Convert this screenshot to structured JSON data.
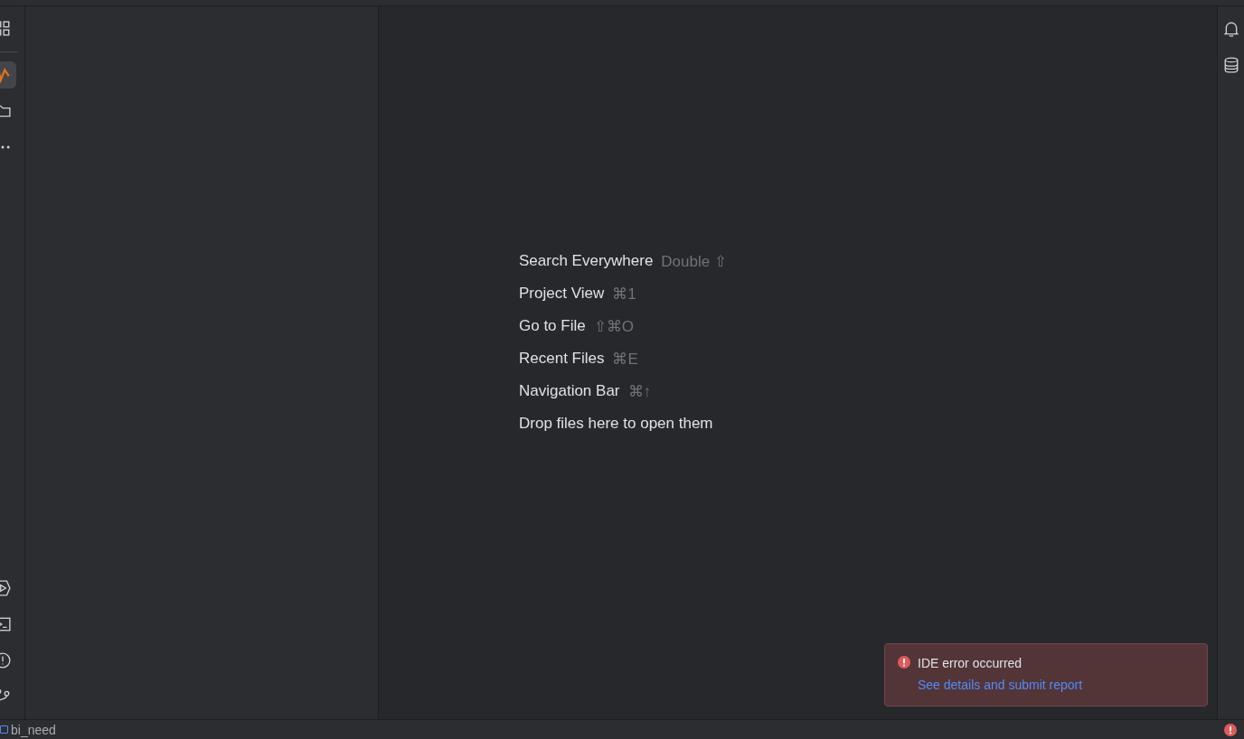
{
  "left_toolbar": {
    "top": [
      {
        "kind": "grid",
        "selected": false
      },
      {
        "kind": "chart",
        "selected": true
      },
      {
        "kind": "folder",
        "selected": false
      },
      {
        "kind": "more",
        "selected": false
      }
    ],
    "bottom": [
      {
        "kind": "run",
        "selected": false
      },
      {
        "kind": "terminal",
        "selected": false
      },
      {
        "kind": "problems",
        "selected": false
      },
      {
        "kind": "branch",
        "selected": false
      }
    ]
  },
  "editor_hints": [
    {
      "label": "Search Everywhere",
      "shortcut": "Double ⇧"
    },
    {
      "label": "Project View",
      "shortcut": "⌘1"
    },
    {
      "label": "Go to File",
      "shortcut": "⇧⌘O"
    },
    {
      "label": "Recent Files",
      "shortcut": "⌘E"
    },
    {
      "label": "Navigation Bar",
      "shortcut": "⌘↑"
    },
    {
      "label": "Drop files here to open them"
    }
  ],
  "right_toolbar": [
    {
      "kind": "bell"
    },
    {
      "kind": "database"
    }
  ],
  "notification": {
    "title": "IDE error occurred",
    "link": "See details and submit report"
  },
  "status_bar": {
    "project": "bi_need"
  }
}
